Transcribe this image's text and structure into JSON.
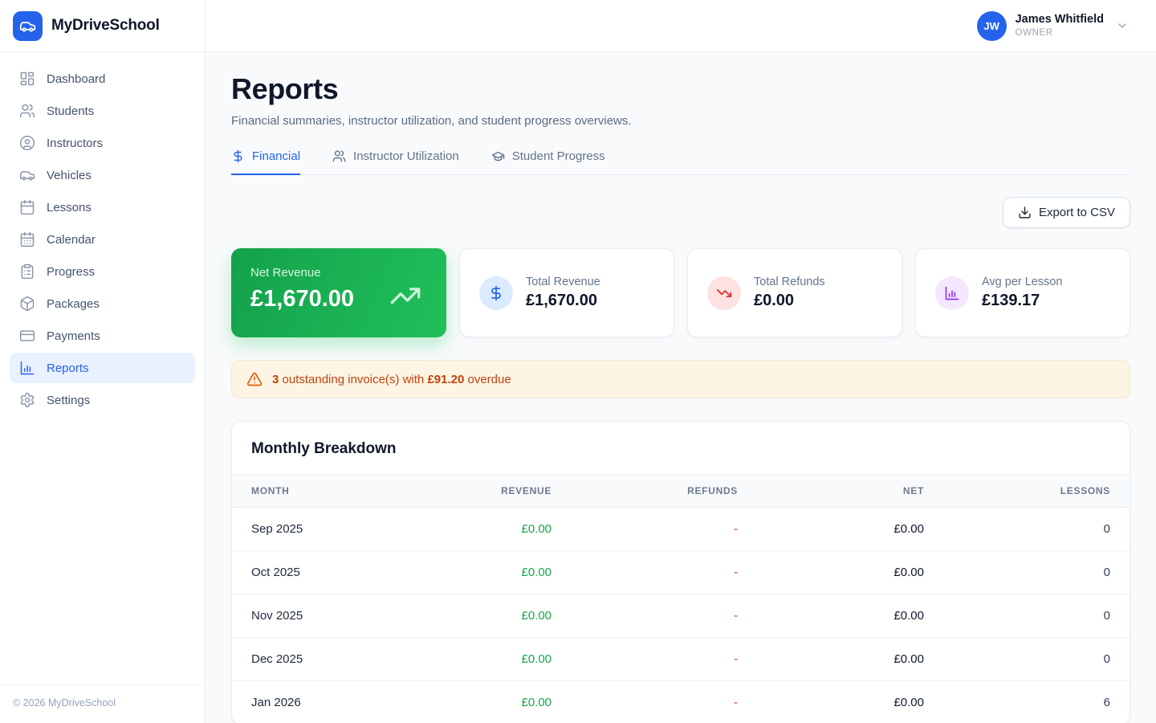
{
  "brand": {
    "name": "MyDriveSchool"
  },
  "sidebar": {
    "items": [
      {
        "label": "Dashboard",
        "icon": "dashboard-icon",
        "active": false
      },
      {
        "label": "Students",
        "icon": "students-icon",
        "active": false
      },
      {
        "label": "Instructors",
        "icon": "instructors-icon",
        "active": false
      },
      {
        "label": "Vehicles",
        "icon": "vehicles-icon",
        "active": false
      },
      {
        "label": "Lessons",
        "icon": "lessons-icon",
        "active": false
      },
      {
        "label": "Calendar",
        "icon": "calendar-icon",
        "active": false
      },
      {
        "label": "Progress",
        "icon": "progress-icon",
        "active": false
      },
      {
        "label": "Packages",
        "icon": "packages-icon",
        "active": false
      },
      {
        "label": "Payments",
        "icon": "payments-icon",
        "active": false
      },
      {
        "label": "Reports",
        "icon": "reports-icon",
        "active": true
      },
      {
        "label": "Settings",
        "icon": "settings-icon",
        "active": false
      }
    ],
    "footer": "© 2026 MyDriveSchool"
  },
  "header": {
    "user": {
      "initials": "JW",
      "name": "James Whitfield",
      "role": "OWNER"
    }
  },
  "page": {
    "title": "Reports",
    "subtitle": "Financial summaries, instructor utilization, and student progress overviews."
  },
  "tabs": [
    {
      "label": "Financial",
      "icon": "dollar-icon",
      "active": true
    },
    {
      "label": "Instructor Utilization",
      "icon": "users-icon",
      "active": false
    },
    {
      "label": "Student Progress",
      "icon": "graduation-cap-icon",
      "active": false
    }
  ],
  "toolbar": {
    "export_label": "Export to CSV"
  },
  "stats": [
    {
      "label": "Net Revenue",
      "value": "£1,670.00",
      "style": "green",
      "icon": "trending-up-icon"
    },
    {
      "label": "Total Revenue",
      "value": "£1,670.00",
      "style": "blue",
      "icon": "dollar-icon"
    },
    {
      "label": "Total Refunds",
      "value": "£0.00",
      "style": "red",
      "icon": "trending-down-icon"
    },
    {
      "label": "Avg per Lesson",
      "value": "£139.17",
      "style": "purple",
      "icon": "bar-chart-icon"
    }
  ],
  "alert": {
    "count": "3",
    "text_1": " outstanding invoice(s) with ",
    "amount": "£91.20",
    "text_2": " overdue"
  },
  "table": {
    "title": "Monthly Breakdown",
    "columns": [
      "Month",
      "Revenue",
      "Refunds",
      "Net",
      "Lessons"
    ],
    "rows": [
      {
        "month": "Sep 2025",
        "revenue": "£0.00",
        "refunds": "-",
        "net": "£0.00",
        "lessons": "0"
      },
      {
        "month": "Oct 2025",
        "revenue": "£0.00",
        "refunds": "-",
        "net": "£0.00",
        "lessons": "0"
      },
      {
        "month": "Nov 2025",
        "revenue": "£0.00",
        "refunds": "-",
        "net": "£0.00",
        "lessons": "0"
      },
      {
        "month": "Dec 2025",
        "revenue": "£0.00",
        "refunds": "-",
        "net": "£0.00",
        "lessons": "0"
      },
      {
        "month": "Jan 2026",
        "revenue": "£0.00",
        "refunds": "-",
        "net": "£0.00",
        "lessons": "6"
      }
    ]
  },
  "colors": {
    "accent_blue": "#2563eb",
    "green_card_start": "#16a34a",
    "green_card_end": "#22c55e",
    "positive_green": "#16a34a",
    "negative_red": "#dc2626",
    "purple": "#9333ea",
    "warning_text": "#c2410c",
    "warning_bg": "#fdf5e4",
    "page_bg": "#f8fafc"
  }
}
